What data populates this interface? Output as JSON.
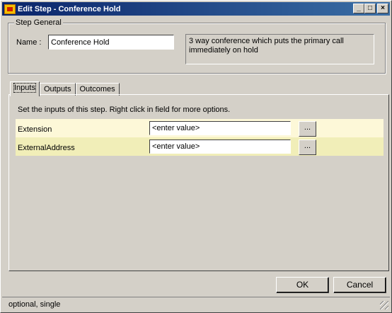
{
  "window": {
    "title": "Edit Step - Conference Hold",
    "buttons": {
      "minimize": "_",
      "maximize": "□",
      "close": "×"
    }
  },
  "step_general": {
    "legend": "Step General",
    "name_label": "Name :",
    "name_value": "Conference Hold",
    "description": "3 way conference which puts the primary call immediately on hold"
  },
  "tabs": [
    {
      "label": "Inputs",
      "active": true
    },
    {
      "label": "Outputs",
      "active": false
    },
    {
      "label": "Outcomes",
      "active": false
    }
  ],
  "inputs_panel": {
    "info": "Set the inputs of this step.  Right click in field for more options.",
    "rows": [
      {
        "label": "Extension",
        "value": "<enter value>",
        "button": "..."
      },
      {
        "label": "ExternalAddress",
        "value": "<enter value>",
        "button": "..."
      }
    ]
  },
  "footer": {
    "ok_label": "OK",
    "cancel_label": "Cancel"
  },
  "status": {
    "text": "optional, single"
  }
}
